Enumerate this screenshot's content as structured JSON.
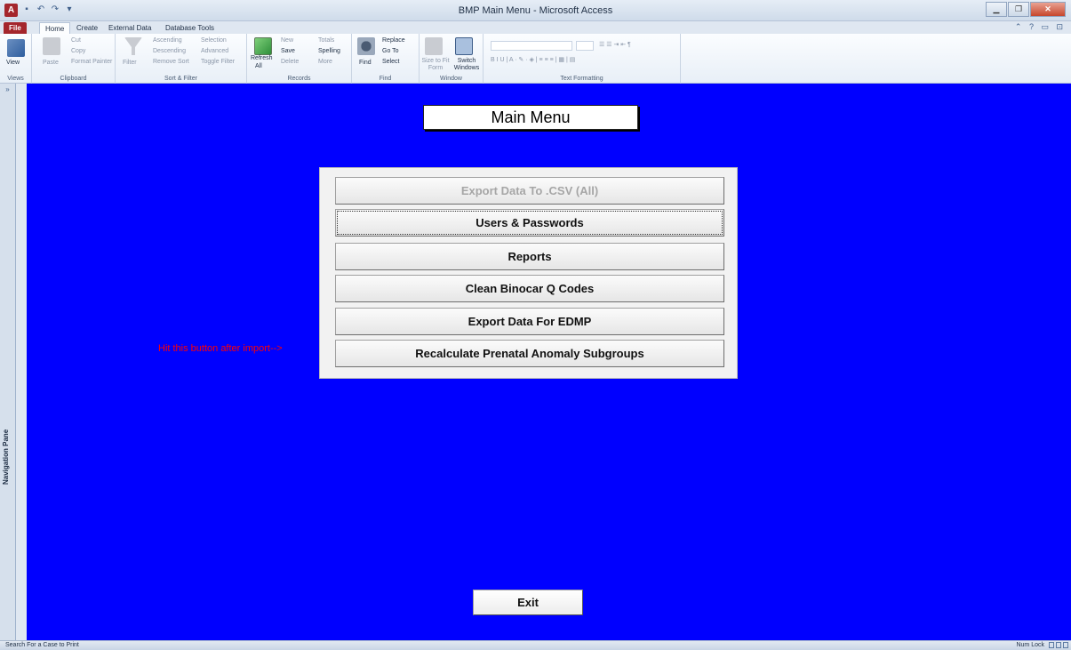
{
  "window": {
    "title": "BMP Main Menu - Microsoft Access",
    "app_icon": "A",
    "controls": [
      "minimize",
      "maximize",
      "close"
    ]
  },
  "ribbon_tabs": [
    {
      "label": "File"
    },
    {
      "label": "Home"
    },
    {
      "label": "Create"
    },
    {
      "label": "External Data"
    },
    {
      "label": "Database Tools"
    }
  ],
  "ribbon": {
    "views": {
      "label": "Views",
      "view": "View"
    },
    "clipboard": {
      "label": "Clipboard",
      "paste": "Paste",
      "cut": "Cut",
      "copy": "Copy",
      "format_painter": "Format Painter"
    },
    "sort_filter": {
      "label": "Sort & Filter",
      "filter": "Filter",
      "ascending": "Ascending",
      "descending": "Descending",
      "remove_sort": "Remove Sort",
      "selection": "Selection",
      "advanced": "Advanced",
      "toggle_filter": "Toggle Filter"
    },
    "records": {
      "label": "Records",
      "refresh": "Refresh",
      "refresh_all": "All",
      "new": "New",
      "save": "Save",
      "delete": "Delete",
      "totals": "Totals",
      "spelling": "Spelling",
      "more": "More"
    },
    "find": {
      "label": "Find",
      "find": "Find",
      "replace": "Replace",
      "go_to": "Go To",
      "select": "Select"
    },
    "window": {
      "label": "Window",
      "size_to_fit": "Size to Fit Form",
      "switch_windows": "Switch Windows"
    },
    "text_formatting": {
      "label": "Text Formatting"
    }
  },
  "nav_pane": {
    "label": "Navigation Pane",
    "toggle": "»"
  },
  "form": {
    "header": "Main Menu",
    "buttons": [
      {
        "label": "Export Data To .CSV (All)",
        "enabled": false
      },
      {
        "label": "Users & Passwords",
        "enabled": true
      },
      {
        "label": "Reports",
        "enabled": true
      },
      {
        "label": "Clean Binocar Q Codes",
        "enabled": true
      },
      {
        "label": "Export Data For EDMP",
        "enabled": true
      },
      {
        "label": "Recalculate Prenatal Anomaly Subgroups",
        "enabled": true
      }
    ],
    "hint": "Hit this button after import-->",
    "exit_label": "Exit",
    "background_color": "#0000ff",
    "hint_color": "#ff0000"
  },
  "status_bar": {
    "left_text": "Search For a Case to Print",
    "right_text": "Num Lock"
  }
}
